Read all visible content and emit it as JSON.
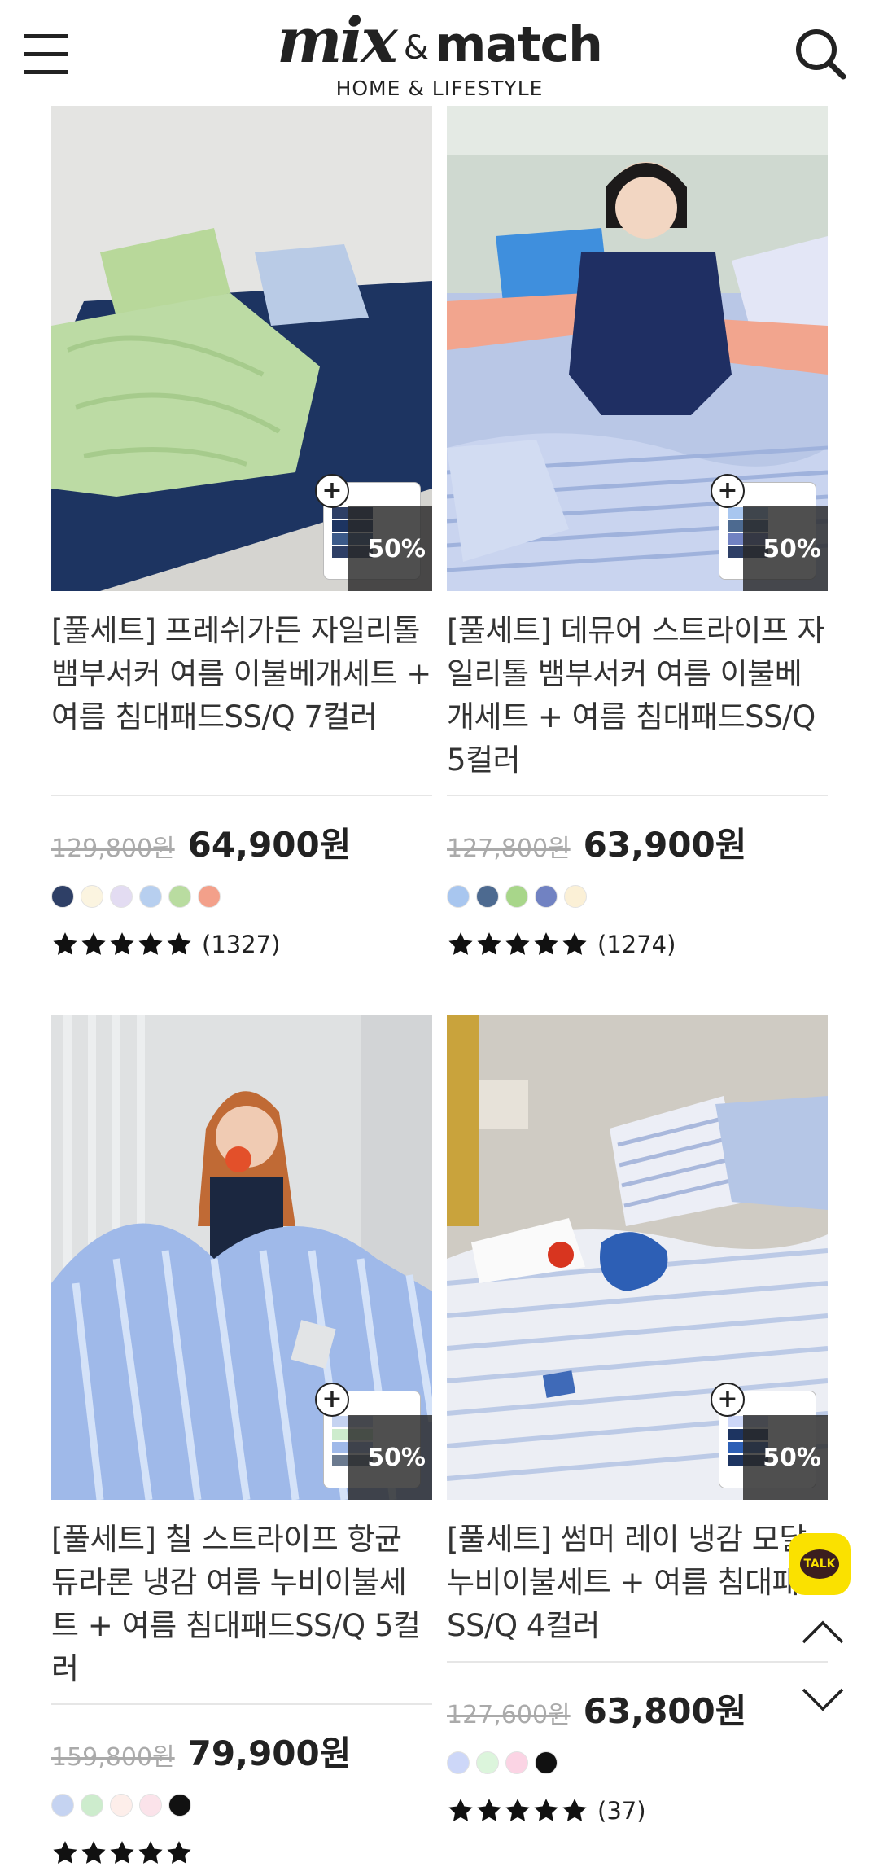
{
  "header": {
    "logo_mix": "mix",
    "logo_amp": "&",
    "logo_match": "match",
    "logo_sub": "HOME & LIFESTYLE",
    "menu_icon": "hamburger-menu-icon",
    "search_icon": "search-icon"
  },
  "products": [
    {
      "title": "[풀세트] 프레쉬가든 자일리톨 뱀부서커 여름 이불베개세트 + 여름 침대패드SS/Q 7컬러",
      "original_price": "129,800원",
      "sale_price": "64,900원",
      "discount": "50%",
      "swatches": [
        "#2e3f66",
        "#fbf4e0",
        "#e3dcf2",
        "#b7cfef",
        "#b9dca0",
        "#f3a08a"
      ],
      "rating": 5,
      "reviews": "(1327)"
    },
    {
      "title": "[풀세트] 데뮤어 스트라이프 자일리톨 뱀부서커 여름 이불베개세트 + 여름 침대패드SS/Q 5컬러",
      "original_price": "127,800원",
      "sale_price": "63,900원",
      "discount": "50%",
      "swatches": [
        "#a8c6ef",
        "#4d6a90",
        "#a8d68a",
        "#7182c2",
        "#fbf0d6"
      ],
      "rating": 5,
      "reviews": "(1274)"
    },
    {
      "title": "[풀세트] 칠 스트라이프 항균 듀라론 냉감 여름 누비이불세트 + 여름 침대패드SS/Q 5컬러",
      "original_price": "159,800원",
      "sale_price": "79,900원",
      "discount": "50%",
      "swatches": [
        "#c5d3f1",
        "#cdeccd",
        "#fdeeea",
        "#fbe3ea",
        "#111111"
      ],
      "rating": 5,
      "reviews": ""
    },
    {
      "title": "[풀세트] 썸머 레이 냉감 모달 누비이불세트 + 여름 침대패드SS/Q 4컬러",
      "original_price": "127,600원",
      "sale_price": "63,800원",
      "discount": "50%",
      "swatches": [
        "#cdd7f8",
        "#dcf5dc",
        "#fbd4e4",
        "#111111"
      ],
      "rating": 5,
      "reviews": "(37)"
    }
  ],
  "floating": {
    "kakao_label": "TALK",
    "kakao_color": "#fae100"
  }
}
